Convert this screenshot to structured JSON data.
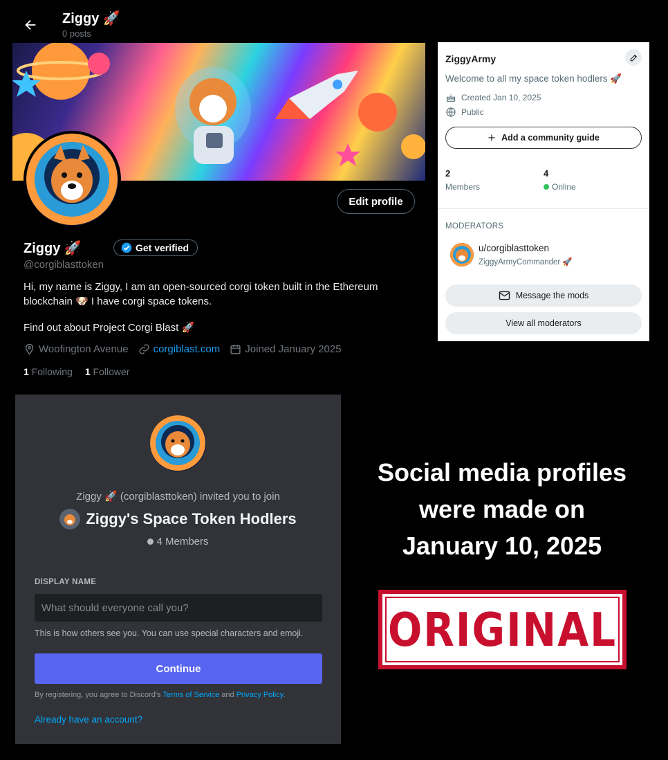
{
  "x_profile": {
    "header_name": "Ziggy 🚀",
    "posts": "0 posts",
    "edit_profile": "Edit profile",
    "name": "Ziggy 🚀",
    "get_verified": "Get verified",
    "handle": "@corgiblasttoken",
    "bio_line1": "Hi, my name is Ziggy, I am an open-sourced corgi token built in the Ethereum blockchain 🐶 I have corgi space tokens.",
    "bio_line2": "Find out about Project Corgi Blast 🚀",
    "location": "Woofington Avenue",
    "website": "corgiblast.com",
    "joined": "Joined January 2025",
    "following_count": "1",
    "following_label": "Following",
    "followers_count": "1",
    "followers_label": "Follower",
    "icons": [
      "back-arrow-icon",
      "location-pin-icon",
      "link-icon",
      "calendar-icon",
      "verified-badge-icon"
    ]
  },
  "reddit_card": {
    "community_name": "ZiggyArmy",
    "description": "Welcome to all my space token hodlers 🚀",
    "created": "Created Jan 10, 2025",
    "visibility": "Public",
    "add_guide": "Add a community guide",
    "members_count": "2",
    "members_label": "Members",
    "online_count": "4",
    "online_label": "Online",
    "moderators_heading": "MODERATORS",
    "mod_username": "u/corgiblasttoken",
    "mod_flair": "ZiggyArmyCommander 🚀",
    "message_mods": "Message the mods",
    "view_all_mods": "View all moderators",
    "icons": [
      "pencil-icon",
      "cake-icon",
      "globe-icon",
      "plus-icon",
      "mail-icon"
    ],
    "online_color": "#2ec55a"
  },
  "discord_invite": {
    "invite_text": "Ziggy 🚀 (corgiblasttoken) invited you to join",
    "server_name": "Ziggy's Space Token Hodlers",
    "members": "4 Members",
    "display_name_label": "DISPLAY NAME",
    "display_name_placeholder": "What should everyone call you?",
    "display_name_value": "",
    "hint": "This is how others see you. You can use special characters and emoji.",
    "continue": "Continue",
    "terms_prefix": "By registering, you agree to Discord's ",
    "terms_link": "Terms of Service",
    "terms_and": " and ",
    "privacy_link": "Privacy Policy",
    "terms_suffix": ".",
    "login_link": "Already have an account?",
    "accent_color": "#5865f2"
  },
  "caption": {
    "line1": "Social media profiles",
    "line2": "were made on",
    "line3": "January 10, 2025"
  },
  "stamp": {
    "text": "ORIGINAL",
    "color": "#c8102e"
  }
}
